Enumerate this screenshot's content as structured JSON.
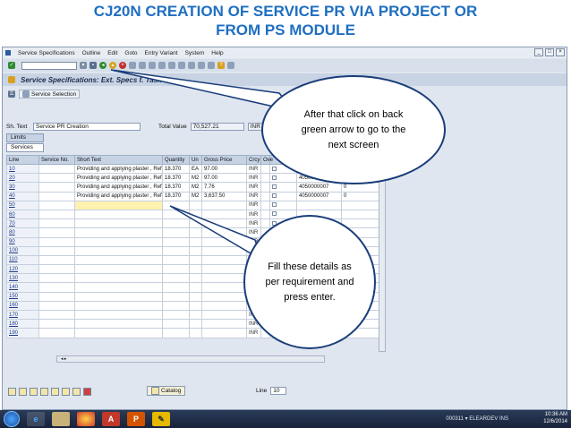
{
  "slide": {
    "title_line1": "CJ20N CREATION OF SERVICE PR VIA PROJECT OR",
    "title_line2": "FROM PS MODULE"
  },
  "menu": [
    "Service Specifications",
    "Outline",
    "Edit",
    "Goto",
    "Entry Variant",
    "System",
    "Help"
  ],
  "window": {
    "title": "Service Specifications: Ext. Specs f. Task L...",
    "service_selection": "Service Selection"
  },
  "header": {
    "sh_text_label": "Sh. Text",
    "sh_text_value": "Service PR Creation",
    "total_value_label": "Total Value",
    "total_value": "70,527.21",
    "currency": "INR"
  },
  "tabs": [
    "Limits",
    "Services"
  ],
  "table": {
    "columns": [
      "Line",
      "Service No.",
      "Short Text",
      "Quantity",
      "Un",
      "Gross Price",
      "Crcy",
      "Ove"
    ],
    "rows": [
      {
        "line": "10",
        "short": "Providing and applying plaster , Ref-..",
        "qty": "18.370",
        "un": "EA",
        "price": "97.00",
        "crcy": "INR",
        "ref": "4050000007",
        "z": "0"
      },
      {
        "line": "20",
        "short": "Providing and applying plaster , Ref-..",
        "qty": "18.370",
        "un": "M2",
        "price": "97.00",
        "crcy": "INR",
        "ref": "4050000007",
        "z": "0"
      },
      {
        "line": "30",
        "short": "Providing and applying plaster , Ref-..",
        "qty": "18.370",
        "un": "M2",
        "price": "7.76",
        "crcy": "INR",
        "ref": "4050000007",
        "z": "0"
      },
      {
        "line": "40",
        "short": "Providing and applying plaster , Ref-..",
        "qty": "18.370",
        "un": "M2",
        "price": "3,637.50",
        "crcy": "INR",
        "ref": "4050000007",
        "z": "0"
      },
      {
        "line": "50",
        "short": "",
        "qty": "",
        "un": "",
        "price": "",
        "crcy": "INR",
        "ref": "",
        "z": ""
      },
      {
        "line": "60",
        "short": "",
        "qty": "",
        "un": "",
        "price": "",
        "crcy": "INR",
        "ref": "",
        "z": ""
      },
      {
        "line": "70",
        "short": "",
        "qty": "",
        "un": "",
        "price": "",
        "crcy": "INR",
        "ref": "",
        "z": ""
      },
      {
        "line": "80",
        "short": "",
        "qty": "",
        "un": "",
        "price": "",
        "crcy": "INR",
        "ref": "",
        "z": ""
      },
      {
        "line": "90",
        "short": "",
        "qty": "",
        "un": "",
        "price": "",
        "crcy": "INR",
        "ref": "",
        "z": ""
      },
      {
        "line": "100",
        "short": "",
        "qty": "",
        "un": "",
        "price": "",
        "crcy": "INR",
        "ref": "",
        "z": ""
      },
      {
        "line": "110",
        "short": "",
        "qty": "",
        "un": "",
        "price": "",
        "crcy": "INR",
        "ref": "",
        "z": ""
      },
      {
        "line": "120",
        "short": "",
        "qty": "",
        "un": "",
        "price": "",
        "crcy": "INR",
        "ref": "",
        "z": ""
      },
      {
        "line": "130",
        "short": "",
        "qty": "",
        "un": "",
        "price": "",
        "crcy": "INR",
        "ref": "",
        "z": ""
      },
      {
        "line": "140",
        "short": "",
        "qty": "",
        "un": "",
        "price": "",
        "crcy": "INR",
        "ref": "",
        "z": ""
      },
      {
        "line": "150",
        "short": "",
        "qty": "",
        "un": "",
        "price": "",
        "crcy": "INR",
        "ref": "",
        "z": ""
      },
      {
        "line": "160",
        "short": "",
        "qty": "",
        "un": "",
        "price": "",
        "crcy": "INR",
        "ref": "",
        "z": ""
      },
      {
        "line": "170",
        "short": "",
        "qty": "",
        "un": "",
        "price": "",
        "crcy": "INR",
        "ref": "",
        "z": ""
      },
      {
        "line": "180",
        "short": "",
        "qty": "",
        "un": "",
        "price": "",
        "crcy": "INR",
        "ref": "",
        "z": ""
      },
      {
        "line": "190",
        "short": "",
        "qty": "",
        "un": "",
        "price": "",
        "crcy": "INR",
        "ref": "",
        "z": ""
      }
    ]
  },
  "bottom": {
    "catalog": "Catalog",
    "line_label": "Line",
    "line_value": "10"
  },
  "callouts": {
    "back": "After that click on back green arrow to go to the next screen",
    "fill": "Fill these details as per requirement and press enter."
  },
  "taskbar": {
    "time": "10:36 AM",
    "date": "12/6/2014",
    "tray_left": "000311 ▾  ELEARDEV  INS"
  },
  "colors": {
    "title_blue": "#1f6fc1",
    "callout_border": "#1a3d7a"
  }
}
